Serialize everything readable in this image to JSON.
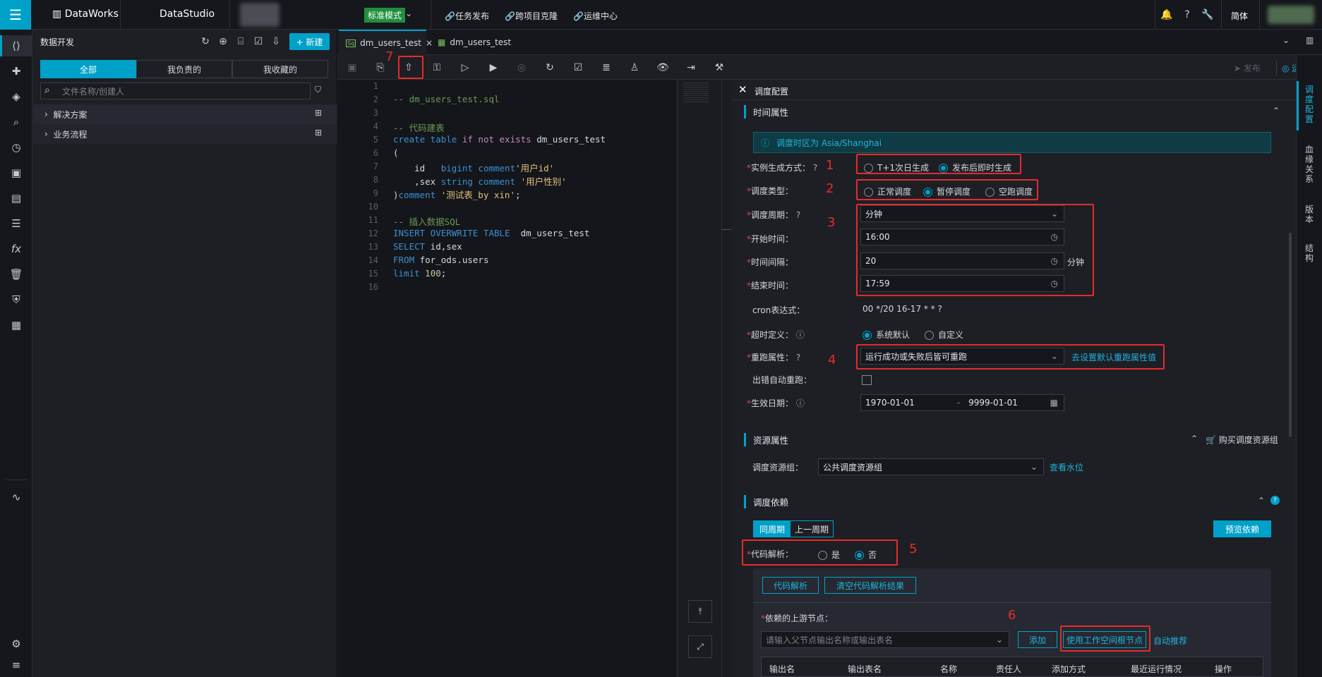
{
  "topbar": {
    "brand": "DataWorks",
    "studio": "DataStudio",
    "mode": "标准模式",
    "nav": [
      "任务发布",
      "跨项目克隆",
      "运维中心"
    ],
    "lang": "简体"
  },
  "panel": {
    "title": "数据开发",
    "new_label": "+ 新建",
    "segments": [
      "全部",
      "我负责的",
      "我收藏的"
    ],
    "search_placeholder": "文件名称/创建人",
    "tree": [
      "解决方案",
      "业务流程"
    ]
  },
  "tabs": [
    {
      "label": "dm_users_test",
      "badge": "Sq"
    },
    {
      "label": "dm_users_test"
    }
  ],
  "toolbar": {
    "publish": "发布",
    "ops": "运维"
  },
  "code_lines": [
    "1",
    "2",
    "3",
    "4",
    "5",
    "6",
    "7",
    "8",
    "9",
    "10",
    "11",
    "12",
    "13",
    "14",
    "15",
    "16"
  ],
  "code": {
    "l2": "-- dm_users_test.sql",
    "l4": "-- 代码建表",
    "l5a": "create table ",
    "l5b": "if not exists",
    "l5c": " dm_users_test",
    "l6": "(",
    "l7a": "    id   ",
    "l7b": "bigint comment",
    "l7c": "'用户id'",
    "l8a": "    ,sex ",
    "l8b": "string comment",
    "l8c": " '用户性别'",
    "l9a": ")",
    "l9b": "comment",
    "l9c": " '测试表_by xin'",
    "l9d": ";",
    "l11": "-- 插入数据SQL",
    "l12a": "INSERT OVERWRITE TABLE",
    "l12b": "  dm_users_test",
    "l13a": "SELECT",
    "l13b": " id,sex",
    "l14a": "FROM",
    "l14b": " for_ods.users",
    "l15a": "limit",
    "l15b": " 100",
    "l15c": ";"
  },
  "config": {
    "header": "调度配置",
    "time_section": "时间属性",
    "timezone_info": "调度时区为 Asia/Shanghai",
    "instance_label": "实例生成方式：",
    "instance_opts": [
      "T+1次日生成",
      "发布后即时生成"
    ],
    "type_label": "调度类型：",
    "type_opts": [
      "正常调度",
      "暂停调度",
      "空跑调度"
    ],
    "period_label": "调度周期：",
    "period_value": "分钟",
    "start_label": "开始时间：",
    "start_value": "16:00",
    "interval_label": "时间间隔：",
    "interval_value": "20",
    "interval_unit": "分钟",
    "end_label": "结束时间：",
    "end_value": "17:59",
    "cron_label": "cron表达式：",
    "cron_value": "00 */20 16-17 * * ?",
    "timeout_label": "超时定义：",
    "timeout_opts": [
      "系统默认",
      "自定义"
    ],
    "rerun_label": "重跑属性：",
    "rerun_value": "运行成功或失败后皆可重跑",
    "rerun_link": "去设置默认重跑属性值",
    "auto_rerun_label": "出错自动重跑：",
    "effective_label": "生效日期：",
    "effective_from": "1970-01-01",
    "effective_sep": "-",
    "effective_to": "9999-01-01",
    "resource_section": "资源属性",
    "buy_link": "购买调度资源组",
    "resgroup_label": "调度资源组：",
    "resgroup_value": "公共调度资源组",
    "water_link": "查看水位",
    "dep_section": "调度依赖",
    "period_tabs": [
      "同周期",
      "上一周期"
    ],
    "preview_btn": "预览依赖",
    "parse_label": "代码解析：",
    "parse_opts": [
      "是",
      "否"
    ],
    "parse_btn": "代码解析",
    "clear_btn": "清空代码解析结果",
    "upstream_label": "依赖的上游节点：",
    "upstream_placeholder": "请输入父节点输出名称或输出表名",
    "add_btn": "添加",
    "root_btn": "使用工作空间根节点",
    "auto_link": "自动推荐",
    "columns": [
      "输出名",
      "输出表名",
      "名称",
      "责任人",
      "添加方式",
      "最近运行情况",
      "操作"
    ]
  },
  "annotations": [
    "1",
    "2",
    "3",
    "4",
    "5",
    "6",
    "7"
  ],
  "right_rail": [
    "调度配置",
    "血缘关系",
    "版本",
    "结构"
  ],
  "colors": {
    "accent": "#00a1c9",
    "annotation": "#e52b2b",
    "bg": "#1d1f25"
  }
}
